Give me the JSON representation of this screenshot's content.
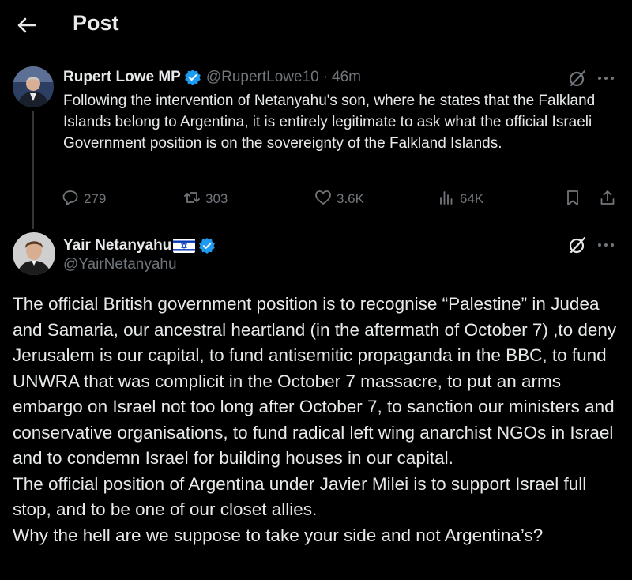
{
  "header": {
    "title": "Post"
  },
  "tweet1": {
    "name": "Rupert Lowe MP",
    "handle": "@RupertLowe10",
    "separator": "·",
    "time": "46m",
    "text": "Following the intervention of Netanyahu's son, where he states that the Falkland Islands belong to Argentina, it is entirely legitimate to ask what the official Israeli Government position is on the sovereignty of the Falkland Islands.",
    "stats": {
      "replies": "279",
      "reposts": "303",
      "likes": "3.6K",
      "views": "64K"
    }
  },
  "tweet2": {
    "name": "Yair Netanyahu",
    "handle": "@YairNetanyahu",
    "paragraphs": [
      "The official British government position is to recognise “Palestine” in Judea and Samaria, our ancestral heartland (in the aftermath of October 7) ,to deny Jerusalem is our capital, to fund antisemitic propaganda in the BBC, to fund UNWRA that was complicit in the October 7 massacre, to put an arms embargo on Israel not too long after October 7, to sanction our ministers and conservative organisations, to fund  radical left wing anarchist NGOs in Israel and to condemn Israel for building houses in our capital.",
      "The official position of Argentina under Javier Milei is to support Israel full stop, and to be one of our closet allies.",
      "Why the hell are we suppose to take your side and not Argentina’s?"
    ]
  },
  "colors": {
    "background": "#000000",
    "text": "#e7e9ea",
    "secondary": "#71767b",
    "verified": "#1d9bf0",
    "thread_line": "#333639"
  },
  "icons": [
    "back-arrow-icon",
    "verified-badge-icon",
    "grok-icon",
    "more-icon",
    "reply-icon",
    "repost-icon",
    "like-icon",
    "views-icon",
    "bookmark-icon",
    "share-icon",
    "israel-flag-icon"
  ]
}
